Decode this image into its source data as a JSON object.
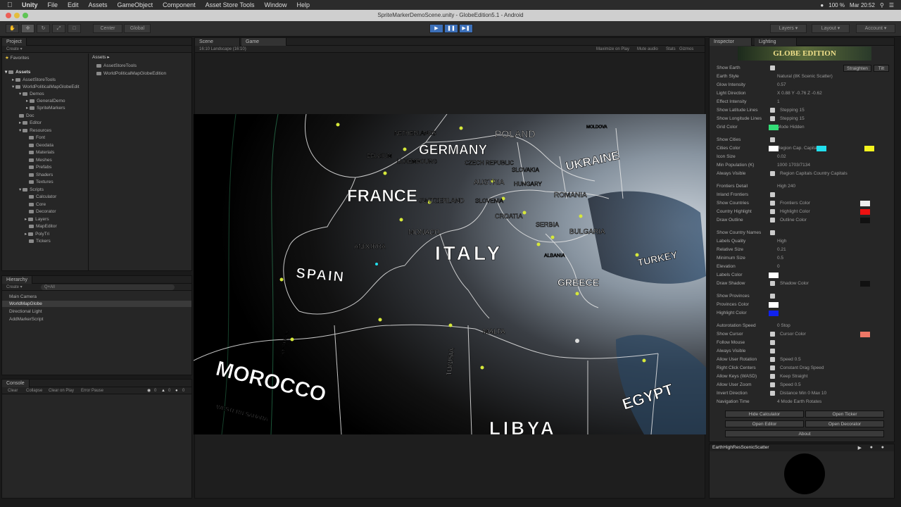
{
  "mac_menu": {
    "app": "Unity",
    "items": [
      "File",
      "Edit",
      "Assets",
      "GameObject",
      "Component",
      "Asset Store Tools",
      "Window",
      "Help"
    ],
    "battery": "100 %",
    "clock": "Mar 20:52"
  },
  "window": {
    "title": "SpriteMarkerDemoScene.unity - GlobeEdition5.1 - Android"
  },
  "toolbar": {
    "center_label": "Center",
    "global_label": "Global",
    "layers_label": "Layers",
    "layout_label": "Layout",
    "account_label": "Account"
  },
  "project": {
    "tab": "Project",
    "create": "Create",
    "favorites": "Favorites",
    "assets_header": "Assets",
    "tree": [
      "Assets",
      "AssetStoreTools",
      "WorldPoliticalMapGlobeEdit",
      "Demos",
      "GeneralDemo",
      "SpriteMarkers",
      "Doc",
      "Editor",
      "Resources",
      "Font",
      "Geodata",
      "Materials",
      "Meshes",
      "Prefabs",
      "Shaders",
      "Textures",
      "Scripts",
      "Calculator",
      "Core",
      "Decorator",
      "Layers",
      "MapEditor",
      "PolyTri",
      "Tickers"
    ],
    "right_items": [
      "AssetStoreTools",
      "WorldPoliticalMapGlobeEdition"
    ]
  },
  "hierarchy": {
    "tab": "Hierarchy",
    "create": "Create",
    "search": "Q+All",
    "items": [
      "Main Camera",
      "WorldMapGlobe",
      "Directional Light",
      "AddMarkerScript"
    ]
  },
  "console": {
    "tab": "Console",
    "buttons": [
      "Clear",
      "Collapse",
      "Clear on Play",
      "Error Pause"
    ],
    "counts": [
      "0",
      "0",
      "0"
    ]
  },
  "scene": {
    "tabs": [
      "Scene",
      "Game"
    ],
    "resolution": "16:10 Landscape (16:10)",
    "right_options": [
      "Maximize on Play",
      "Mute audio",
      "Stats",
      "Gizmos"
    ]
  },
  "map": {
    "countries": [
      {
        "name": "POLAND"
      },
      {
        "name": "GERMANY"
      },
      {
        "name": "UKRAINE"
      },
      {
        "name": "FRANCE"
      },
      {
        "name": "ITALY"
      },
      {
        "name": "SPAIN"
      },
      {
        "name": "GREECE"
      },
      {
        "name": "TURKEY"
      },
      {
        "name": "MOROCCO"
      },
      {
        "name": "TUNISIA"
      },
      {
        "name": "MALTA"
      },
      {
        "name": "EGYPT"
      },
      {
        "name": "LIBYA"
      },
      {
        "name": "ROMANIA"
      },
      {
        "name": "BULGARIA"
      },
      {
        "name": "AUSTRIA"
      },
      {
        "name": "HUNGARY"
      },
      {
        "name": "SLOVAKIA"
      },
      {
        "name": "CZECH REPUBLIC"
      },
      {
        "name": "NETHERLANDS"
      },
      {
        "name": "BELGIUM"
      },
      {
        "name": "LUXEMBOURG"
      },
      {
        "name": "SWITZERLAND"
      },
      {
        "name": "SLOVENIA"
      },
      {
        "name": "CROATIA"
      },
      {
        "name": "SERBIA"
      },
      {
        "name": "MONACO"
      },
      {
        "name": "ANDORRA"
      },
      {
        "name": "PORTUGAL"
      },
      {
        "name": "ALBANIA"
      },
      {
        "name": "MOLDOVA"
      },
      {
        "name": "WESTERN SAHARA"
      }
    ]
  },
  "inspector": {
    "tab": "Inspector",
    "tab2": "Lighting",
    "banner": "GLOBE EDITION",
    "rows": [
      {
        "label": "Show Earth",
        "value": ""
      },
      {
        "label": "Earth Style",
        "value": "Natural (8K Scenic Scatter)"
      },
      {
        "label": "Glow Intensity",
        "value": "0.57"
      },
      {
        "label": "Light Direction",
        "value": "X 0.88   Y -0.76   Z -0.62"
      },
      {
        "label": "Effect Intensity",
        "value": "1"
      },
      {
        "label": "Show Latitude Lines",
        "value": "Stepping 15"
      },
      {
        "label": "Show Longitude Lines",
        "value": "Stepping 15"
      },
      {
        "label": "Grid Color",
        "value": "Mode  Hidden"
      },
      {
        "label": "Show Cities",
        "value": ""
      },
      {
        "label": "Cities Color",
        "value": "Region Cap.   Capital"
      },
      {
        "label": "Icon Size",
        "value": "0.02"
      },
      {
        "label": "Min Population (K)",
        "value": "1000   1703/7134"
      },
      {
        "label": "Always Visible",
        "value": "Region Capitals   Country Capitals"
      },
      {
        "label": "Frontiers Detail",
        "value": "High   240"
      },
      {
        "label": "Inland Frontiers",
        "value": ""
      },
      {
        "label": "Show Countries",
        "value": "Frontiers Color"
      },
      {
        "label": "Country Highlight",
        "value": "Highlight Color"
      },
      {
        "label": "Draw Outline",
        "value": "Outline Color"
      },
      {
        "label": "Show Country Names",
        "value": ""
      },
      {
        "label": "Labels Quality",
        "value": "High"
      },
      {
        "label": "Relative Size",
        "value": "0.21"
      },
      {
        "label": "Minimum Size",
        "value": "0.5"
      },
      {
        "label": "Elevation",
        "value": "0"
      },
      {
        "label": "Labels Color",
        "value": ""
      },
      {
        "label": "Draw Shadow",
        "value": "Shadow Color"
      },
      {
        "label": "Show Provinces",
        "value": ""
      },
      {
        "label": "Provinces Color",
        "value": ""
      },
      {
        "label": "Highlight Color",
        "value": ""
      },
      {
        "label": "Autorotation Speed",
        "value": "0   Stop"
      },
      {
        "label": "Show Cursor",
        "value": "Cursor Color"
      },
      {
        "label": "Follow Mouse",
        "value": ""
      },
      {
        "label": "Always Visible",
        "value": ""
      },
      {
        "label": "Allow User Rotation",
        "value": "Speed 0.5"
      },
      {
        "label": "Right Click Centers",
        "value": "Constant Drag Speed"
      },
      {
        "label": "Allow Keys (WASD)",
        "value": "Keep Straight"
      },
      {
        "label": "Allow User Zoom",
        "value": "Speed 0.5"
      },
      {
        "label": "Invert Direction",
        "value": "Distance Min 0   Max 10"
      },
      {
        "label": "Navigation Time",
        "value": "4   Mode  Earth Rotates"
      }
    ],
    "top_buttons": [
      "Straighten",
      "Tilt"
    ],
    "bottom_buttons": [
      "Hide Calculator",
      "Open Ticker",
      "Open Editor",
      "Open Decorator",
      "About"
    ],
    "material": "EarthHighResScenicScatter"
  },
  "colors": {
    "grid": "#33dd77",
    "cities": "#ffffff",
    "region_cap": "#22e0ee",
    "capital": "#f4f41e",
    "frontiers": "#eeeeee",
    "highlight": "#ee1111",
    "outline": "#111111",
    "labels": "#ffffff",
    "shadow": "#111111",
    "provinces": "#ffffff",
    "prov_highlight": "#1122ee",
    "cursor": "#ee7766"
  }
}
